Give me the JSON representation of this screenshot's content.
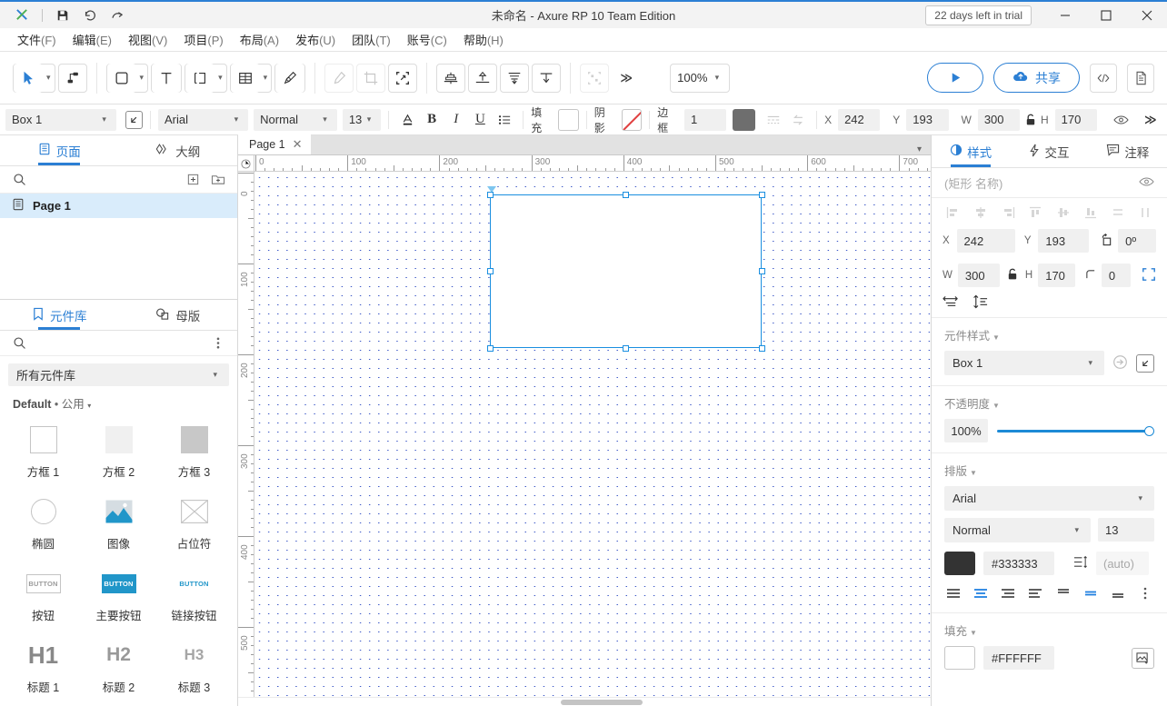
{
  "titlebar": {
    "app_logo": "axure-logo-icon",
    "title": "未命名 - Axure RP 10 Team Edition",
    "trial_badge": "22 days left in trial",
    "icons": [
      "save-icon",
      "undo-icon",
      "redo-icon"
    ],
    "window_controls": [
      "minimize-icon",
      "maximize-icon",
      "close-icon"
    ]
  },
  "menubar": {
    "items": [
      {
        "label": "文件",
        "key": "(F)"
      },
      {
        "label": "编辑",
        "key": "(E)"
      },
      {
        "label": "视图",
        "key": "(V)"
      },
      {
        "label": "项目",
        "key": "(P)"
      },
      {
        "label": "布局",
        "key": "(A)"
      },
      {
        "label": "发布",
        "key": "(U)"
      },
      {
        "label": "团队",
        "key": "(T)"
      },
      {
        "label": "账号",
        "key": "(C)"
      },
      {
        "label": "帮助",
        "key": "(H)"
      }
    ]
  },
  "toolbar": {
    "zoom_value": "100%",
    "share_label": "共享",
    "overflow_label": "≫",
    "tools": [
      "select-tool-icon",
      "connector-tool-icon",
      "rectangle-tool-icon",
      "text-tool-icon",
      "dynamic-panel-tool-icon",
      "table-tool-icon",
      "pen-tool-icon",
      "eyedropper-icon",
      "crop-icon",
      "transform-icon",
      "align-center-icon",
      "align-top-icon",
      "distribute-horizontal-icon",
      "distribute-vertical-icon",
      "group-icon"
    ]
  },
  "formatbar": {
    "style_value": "Box 1",
    "font_family": "Arial",
    "font_weight": "Normal",
    "font_size": "13",
    "fill_label": "填充",
    "shadow_label": "阴影",
    "border_label": "边框",
    "border_width": "1",
    "fill_color": "#FFFFFF",
    "border_color": "#6E6E6E",
    "x_label": "X",
    "x_value": "242",
    "y_label": "Y",
    "y_value": "193",
    "w_label": "W",
    "w_value": "300",
    "h_label": "H",
    "h_value": "170",
    "overflow_label": "≫"
  },
  "leftpanel": {
    "tabs": [
      {
        "label": "页面",
        "icon": "pages-icon",
        "active": true
      },
      {
        "label": "大纲",
        "icon": "outline-icon",
        "active": false
      }
    ],
    "pages": [
      {
        "label": "Page 1",
        "icon": "page-icon",
        "selected": true
      }
    ],
    "lib_tabs": [
      {
        "label": "元件库",
        "icon": "library-icon",
        "active": true
      },
      {
        "label": "母版",
        "icon": "masters-icon",
        "active": false
      }
    ],
    "library_select": "所有元件库",
    "library_group": {
      "name": "Default",
      "sep": "•",
      "scope": "公用"
    },
    "widgets": [
      {
        "label": "方框 1",
        "icon": "box1-icon"
      },
      {
        "label": "方框 2",
        "icon": "box2-icon"
      },
      {
        "label": "方框 3",
        "icon": "box3-icon"
      },
      {
        "label": "椭圆",
        "icon": "ellipse-icon"
      },
      {
        "label": "图像",
        "icon": "image-icon"
      },
      {
        "label": "占位符",
        "icon": "placeholder-icon"
      },
      {
        "label": "按钮",
        "icon": "button-icon"
      },
      {
        "label": "主要按钮",
        "icon": "primary-button-icon"
      },
      {
        "label": "链接按钮",
        "icon": "link-button-icon"
      },
      {
        "label": "标题 1",
        "icon": "h1-icon",
        "glyph": "H1"
      },
      {
        "label": "标题 2",
        "icon": "h2-icon",
        "glyph": "H2"
      },
      {
        "label": "标题 3",
        "icon": "h3-icon",
        "glyph": "H3"
      }
    ],
    "widget_glyphs": {
      "button": "BUTTON"
    }
  },
  "canvas": {
    "tab_label": "Page 1",
    "h_ruler_ticks": [
      "0",
      "100",
      "200",
      "300",
      "400",
      "500",
      "600",
      "700"
    ],
    "v_ruler_ticks": [
      "0",
      "100",
      "200",
      "300",
      "400",
      "500"
    ],
    "selection": {
      "x": "242",
      "y": "193",
      "w": "300",
      "h": "170"
    }
  },
  "rightpanel": {
    "tabs": [
      {
        "label": "样式",
        "icon": "style-icon",
        "active": true
      },
      {
        "label": "交互",
        "icon": "interaction-icon",
        "active": false
      },
      {
        "label": "注释",
        "icon": "notes-icon",
        "active": false
      }
    ],
    "name_placeholder": "(矩形 名称)",
    "geometry": {
      "x_label": "X",
      "x_value": "242",
      "y_label": "Y",
      "y_value": "193",
      "rotation_value": "0º",
      "w_label": "W",
      "w_value": "300",
      "h_label": "H",
      "h_value": "170",
      "radius_value": "0"
    },
    "widget_style": {
      "title": "元件样式",
      "value": "Box 1"
    },
    "opacity": {
      "title": "不透明度",
      "value": "100%"
    },
    "typography": {
      "title": "排版",
      "font_family": "Arial",
      "font_weight": "Normal",
      "font_size": "13",
      "color": "#333333",
      "line_height": "(auto)"
    },
    "fill": {
      "title": "填充",
      "color": "#FFFFFF"
    }
  },
  "colors": {
    "accent": "#2b7fd4",
    "selection": "#1a8fe0",
    "grid_dot": "#3b57c7",
    "text_color": "#333333",
    "fill_color": "#FFFFFF",
    "border_color": "#6E6E6E"
  }
}
